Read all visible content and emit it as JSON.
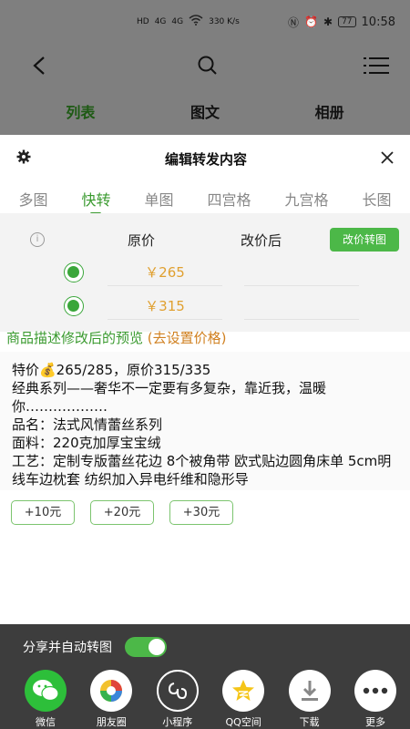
{
  "status_bar": {
    "net_speed": "330\nK/s",
    "net_speed_text": "330 K/s",
    "battery": "77",
    "time": "10:58",
    "sim_labels": [
      "HD",
      "HD"
    ],
    "signal": [
      "4G",
      "4G"
    ]
  },
  "background_app": {
    "tabs": [
      {
        "label": "列表"
      },
      {
        "label": "图文"
      },
      {
        "label": "相册"
      }
    ]
  },
  "sheet": {
    "title": "编辑转发内容",
    "mode_tabs": [
      {
        "label": "多图"
      },
      {
        "label": "快转"
      },
      {
        "label": "单图"
      },
      {
        "label": "四宫格"
      },
      {
        "label": "九宫格"
      },
      {
        "label": "长图"
      }
    ],
    "price_table": {
      "col_original": "原价",
      "col_new": "改价后",
      "convert_button": "改价转图",
      "rows": [
        {
          "original": "￥265",
          "new": ""
        },
        {
          "original": "￥315",
          "new": ""
        }
      ]
    },
    "preview_label": "商品描述修改后的预览",
    "preview_action": "(去设置价格)",
    "description": [
      "特价💰265/285，原价315/335",
      "经典系列——奢华不一定要有多复杂，靠近我，温暖你………………",
      "品名：法式风情蕾丝系列",
      "面料：220克加厚宝宝绒",
      "工艺：定制专版蕾丝花边 8个被角带 欧式贴边圆角床单 5cm明线车边枕套 纺织加入异电纤维和隐形导"
    ],
    "add_buttons": [
      "+10元",
      "+20元",
      "+30元"
    ]
  },
  "share_bar": {
    "toggle_label": "分享并自动转图",
    "toggle_on": true,
    "targets": [
      {
        "label": "微信",
        "icon": "wechat-icon",
        "color": "#2dbf3a"
      },
      {
        "label": "朋友圈",
        "icon": "moments-icon",
        "color": "#ffffff"
      },
      {
        "label": "小程序",
        "icon": "miniprogram-icon",
        "color": "#3d3d3d"
      },
      {
        "label": "QQ空间",
        "icon": "qzone-icon",
        "color": "#ffffff"
      },
      {
        "label": "下载",
        "icon": "download-icon",
        "color": "#ffffff"
      },
      {
        "label": "更多",
        "icon": "more-icon",
        "color": "#ffffff"
      }
    ]
  },
  "colors": {
    "accent": "#4cb848",
    "price": "#e0a030",
    "preview_action": "#d08020"
  }
}
